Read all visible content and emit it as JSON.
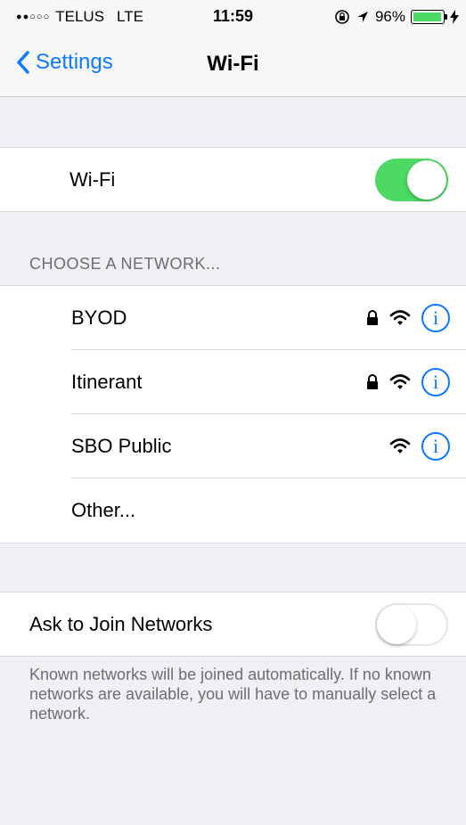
{
  "status_bar": {
    "signal": "●●○○○",
    "carrier": "TELUS",
    "network": "LTE",
    "time": "11:59",
    "battery_percent": "96%",
    "battery_level": 0.96
  },
  "nav": {
    "back_label": "Settings",
    "title": "Wi-Fi"
  },
  "wifi": {
    "label": "Wi-Fi",
    "enabled": true
  },
  "networks_header": "CHOOSE A NETWORK...",
  "networks": [
    {
      "name": "BYOD",
      "secured": true,
      "info": "i"
    },
    {
      "name": "Itinerant",
      "secured": true,
      "info": "i"
    },
    {
      "name": "SBO Public",
      "secured": false,
      "info": "i"
    }
  ],
  "other_label": "Other...",
  "ask_to_join": {
    "label": "Ask to Join Networks",
    "enabled": false
  },
  "footer_note": "Known networks will be joined automatically. If no known networks are available, you will have to manually select a network.",
  "colors": {
    "accent": "#0a7aff",
    "toggle_on": "#4cd964",
    "background": "#efeff4"
  }
}
